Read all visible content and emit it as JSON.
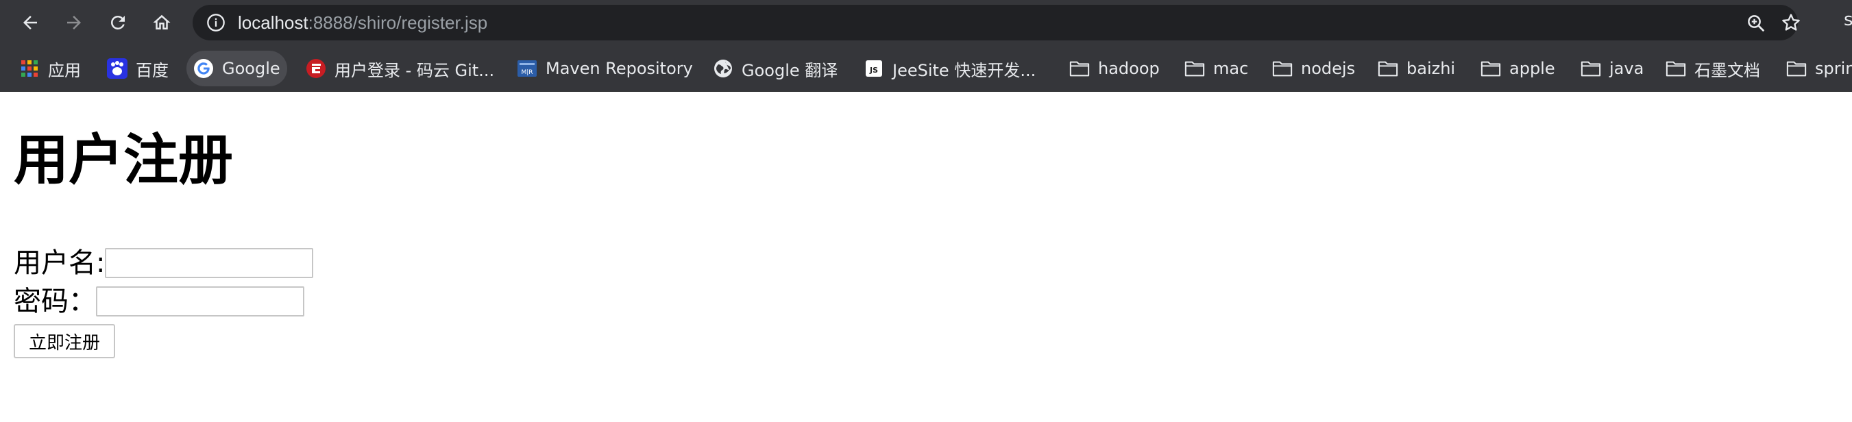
{
  "browser": {
    "url_host": "localhost",
    "url_rest": ":8888/shiro/register.jsp",
    "truncated_text": "s"
  },
  "bookmarks": [
    {
      "label": "应用",
      "icon": "apps-grid-icon"
    },
    {
      "label": "百度",
      "icon": "baidu-paw-icon"
    },
    {
      "label": "Google",
      "icon": "google-icon"
    },
    {
      "label": "用户登录 - 码云 Git...",
      "icon": "gitee-icon"
    },
    {
      "label": "Maven Repository",
      "icon": "maven-icon"
    },
    {
      "label": "Google 翻译",
      "icon": "globe-icon"
    },
    {
      "label": "JeeSite 快速开发...",
      "icon": "js-icon"
    },
    {
      "label": "hadoop",
      "icon": "folder-icon"
    },
    {
      "label": "mac",
      "icon": "folder-icon"
    },
    {
      "label": "nodejs",
      "icon": "folder-icon"
    },
    {
      "label": "baizhi",
      "icon": "folder-icon"
    },
    {
      "label": "apple",
      "icon": "folder-icon"
    },
    {
      "label": "java",
      "icon": "folder-icon"
    },
    {
      "label": "石墨文档",
      "icon": "folder-icon"
    },
    {
      "label": "sprin",
      "icon": "folder-icon"
    }
  ],
  "page": {
    "title": "用户注册",
    "username_label": "用户名:",
    "username_value": "",
    "password_label": "密码：",
    "password_value": "",
    "submit_label": "立即注册"
  },
  "colors": {
    "chrome_bg": "#35363a",
    "omnibox_bg": "#202124",
    "chrome_text": "#e8eaed",
    "url_dim_text": "#9aa0a6"
  }
}
